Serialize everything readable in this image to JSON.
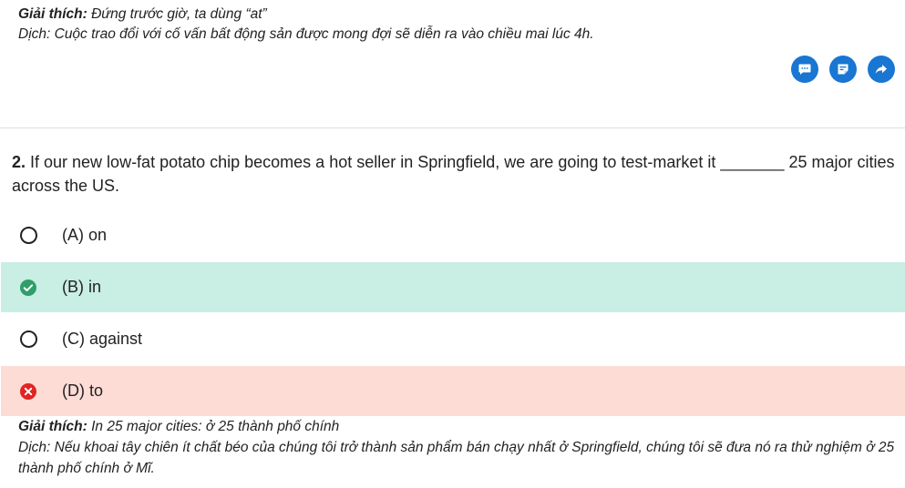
{
  "prev_explanation": {
    "label": "Giải thích:",
    "text": " Đứng trước giờ, ta dùng “at”",
    "translation": "Dịch: Cuộc trao đổi với cố vấn bất động sản được mong đợi sẽ diễn ra vào chiều mai lúc 4h."
  },
  "actions": [
    {
      "icon": "comment-icon"
    },
    {
      "icon": "note-icon"
    },
    {
      "icon": "share-icon"
    }
  ],
  "question": {
    "number": "2.",
    "text": " If our new low-fat potato chip becomes a hot seller in Springfield, we are going to test-market it _______ 25 major cities across the US."
  },
  "options": [
    {
      "label": "(A) on",
      "state": "unselected"
    },
    {
      "label": "(B) in",
      "state": "correct"
    },
    {
      "label": "(C) against",
      "state": "unselected"
    },
    {
      "label": "(D) to",
      "state": "wrong"
    }
  ],
  "explanation": {
    "label": "Giải thích:",
    "text": " In 25 major cities: ở 25 thành phố chính",
    "translation": "Dịch: Nếu khoai tây chiên ít chất béo của chúng tôi trở thành sản phẩm bán chạy nhất ở Springfield, chúng tôi sẽ đưa nó ra thử nghiệm ở 25 thành phố chính ở Mĩ."
  },
  "colors": {
    "accent": "#1976d2",
    "correct_bg": "#c9eee3",
    "correct_icon": "#2e9e6a",
    "wrong_bg": "#fddcd6",
    "wrong_icon": "#e02424"
  }
}
